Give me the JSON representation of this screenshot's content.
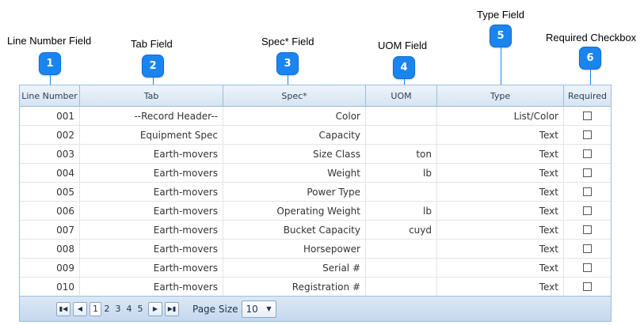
{
  "callouts": [
    {
      "number": "1",
      "label": "Line Number Field"
    },
    {
      "number": "2",
      "label": "Tab Field"
    },
    {
      "number": "3",
      "label": "Spec* Field"
    },
    {
      "number": "4",
      "label": "UOM Field"
    },
    {
      "number": "5",
      "label": "Type Field"
    },
    {
      "number": "6",
      "label": "Required Checkbox"
    }
  ],
  "grid": {
    "columns": [
      "Line Number",
      "Tab",
      "Spec*",
      "UOM",
      "Type",
      "Required"
    ],
    "rows": [
      {
        "line": "001",
        "tab": "--Record Header--",
        "spec": "Color",
        "uom": "",
        "type": "List/Color",
        "required": false
      },
      {
        "line": "002",
        "tab": "Equipment Spec",
        "spec": "Capacity",
        "uom": "",
        "type": "Text",
        "required": false
      },
      {
        "line": "003",
        "tab": "Earth-movers",
        "spec": "Size Class",
        "uom": "ton",
        "type": "Text",
        "required": false
      },
      {
        "line": "004",
        "tab": "Earth-movers",
        "spec": "Weight",
        "uom": "lb",
        "type": "Text",
        "required": false
      },
      {
        "line": "005",
        "tab": "Earth-movers",
        "spec": "Power Type",
        "uom": "",
        "type": "Text",
        "required": false
      },
      {
        "line": "006",
        "tab": "Earth-movers",
        "spec": "Operating Weight",
        "uom": "lb",
        "type": "Text",
        "required": false
      },
      {
        "line": "007",
        "tab": "Earth-movers",
        "spec": "Bucket Capacity",
        "uom": "cuyd",
        "type": "Text",
        "required": false
      },
      {
        "line": "008",
        "tab": "Earth-movers",
        "spec": "Horsepower",
        "uom": "",
        "type": "Text",
        "required": false
      },
      {
        "line": "009",
        "tab": "Earth-movers",
        "spec": "Serial #",
        "uom": "",
        "type": "Text",
        "required": false
      },
      {
        "line": "010",
        "tab": "Earth-movers",
        "spec": "Registration #",
        "uom": "",
        "type": "Text",
        "required": false
      }
    ]
  },
  "pager": {
    "first_icon": "first-page-icon",
    "prev_icon": "prev-page-icon",
    "next_icon": "next-page-icon",
    "last_icon": "last-page-icon",
    "pages": [
      "1",
      "2",
      "3",
      "4",
      "5"
    ],
    "current_page": "1",
    "page_size_label": "Page Size",
    "page_size_value": "10"
  },
  "colors": {
    "badge": "#1a84f0",
    "header_bg": "#d6e4f3",
    "border": "#9dbcd9"
  }
}
